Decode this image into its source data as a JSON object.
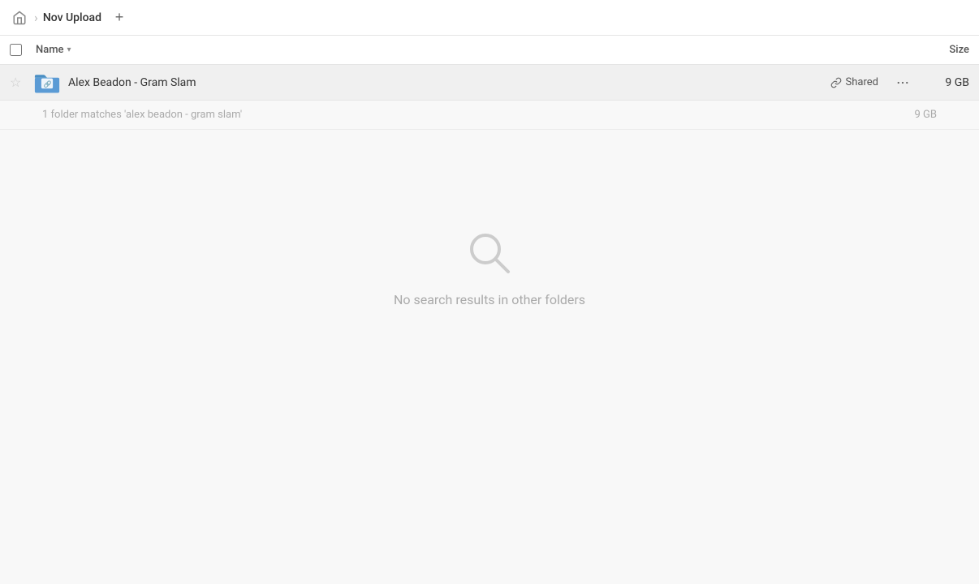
{
  "breadcrumb": {
    "home_icon": "🏠",
    "separator": "›",
    "current_folder": "Nov Upload",
    "add_tab_label": "+"
  },
  "column_header": {
    "name_label": "Name",
    "sort_icon": "▾",
    "size_label": "Size"
  },
  "file_row": {
    "star_icon": "☆",
    "name": "Alex Beadon - Gram Slam",
    "shared_label": "Shared",
    "more_icon": "···",
    "size": "9 GB"
  },
  "match_row": {
    "text": "1 folder matches 'alex beadon - gram slam'",
    "size": "9 GB"
  },
  "empty_state": {
    "message": "No search results in other folders"
  },
  "colors": {
    "folder_blue": "#5b9bd5",
    "folder_dark": "#4a7fb5",
    "link_overlay": "#5b9bd5"
  }
}
